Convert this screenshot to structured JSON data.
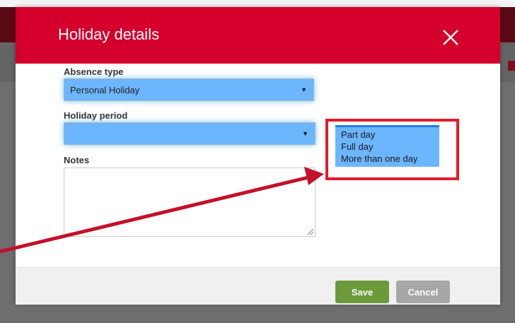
{
  "modal": {
    "title": "Holiday details",
    "close_icon": "close-icon"
  },
  "form": {
    "absence_type": {
      "label": "Absence type",
      "value": "Personal Holiday"
    },
    "holiday_period": {
      "label": "Holiday period",
      "value": "",
      "options": [
        "Part day",
        "Full day",
        "More than one day"
      ]
    },
    "notes": {
      "label": "Notes",
      "value": ""
    }
  },
  "footer": {
    "save_label": "Save",
    "cancel_label": "Cancel"
  },
  "colors": {
    "header": "#d4002b",
    "select_highlight": "#6cb6ff",
    "save": "#6a9a3a",
    "cancel": "#a7a7a7",
    "annotation": "#c4102a"
  }
}
